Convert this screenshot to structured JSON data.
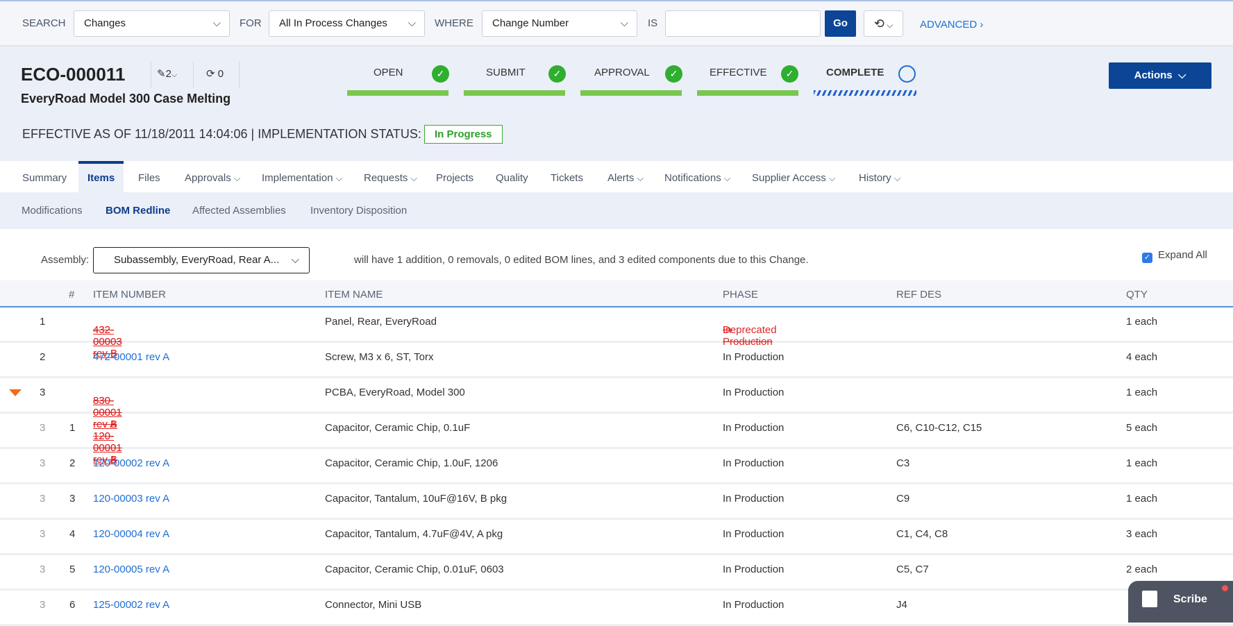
{
  "search": {
    "search_label": "SEARCH",
    "search_value": "Changes",
    "for_label": "FOR",
    "for_value": "All In Process Changes",
    "where_label": "WHERE",
    "where_value": "Change Number",
    "is_label": "IS",
    "is_value": "",
    "go_label": "Go",
    "advanced_label": "ADVANCED"
  },
  "header": {
    "number": "ECO-000011",
    "title": "EveryRoad Model 300 Case Melting",
    "revisions_count": "2",
    "related_count": "0",
    "effective_text": "EFFECTIVE AS OF 11/18/2011 14:04:06 | IMPLEMENTATION STATUS:",
    "status": "In Progress",
    "actions_label": "Actions",
    "steps": [
      {
        "label": "OPEN",
        "done": true
      },
      {
        "label": "SUBMIT",
        "done": true
      },
      {
        "label": "APPROVAL",
        "done": true
      },
      {
        "label": "EFFECTIVE",
        "done": true
      },
      {
        "label": "COMPLETE",
        "done": false
      }
    ]
  },
  "colors": {
    "brand": "#0c4596",
    "complete": "#7ac74f",
    "check": "#2fae2f",
    "redline": "#e02525",
    "link": "#1f6fd1"
  },
  "tabs": [
    "Summary",
    "Items",
    "Files",
    "Approvals",
    "Implementation",
    "Requests",
    "Projects",
    "Quality",
    "Tickets",
    "Alerts",
    "Notifications",
    "Supplier Access",
    "History"
  ],
  "subtabs": [
    "Modifications",
    "BOM Redline",
    "Affected Assemblies",
    "Inventory Disposition"
  ],
  "bom": {
    "assembly_label": "Assembly:",
    "assembly_value": "Subassembly, EveryRoad, Rear A...",
    "summary": "will have 1 addition, 0 removals, 0 edited BOM lines, and 3 edited components due to this Change.",
    "expand_all_label": "Expand All",
    "expand_all_checked": true,
    "columns": [
      "#",
      "ITEM NUMBER",
      "ITEM NAME",
      "PHASE",
      "REF DES",
      "QTY"
    ],
    "rows": [
      {
        "parent": "",
        "num": "1",
        "old_item": "432-00003 rev B",
        "item": "432-00003 rev B",
        "name": "Panel, Rear, EveryRoad",
        "old_phase": "In Production",
        "phase": "Deprecated",
        "refdes": "",
        "qty": "1 each"
      },
      {
        "parent": "",
        "num": "2",
        "old_item": "",
        "item": "472-00001 rev A",
        "name": "Screw, M3 x 6, ST, Torx",
        "old_phase": "",
        "phase": "In Production",
        "refdes": "",
        "qty": "4 each"
      },
      {
        "parent": "",
        "num": "3",
        "old_item": "830-00001 rev A",
        "item": "830-00001 rev B",
        "name": "PCBA, EveryRoad, Model 300",
        "old_phase": "",
        "phase": "In Production",
        "refdes": "",
        "qty": "1 each",
        "expanded": true
      },
      {
        "parent": "3",
        "num": "1",
        "old_item": "120-00001 rev A",
        "item": "120-00001 rev B",
        "name": "Capacitor, Ceramic Chip, 0.1uF",
        "old_phase": "",
        "phase": "In Production",
        "refdes": "C6, C10-C12, C15",
        "qty": "5 each"
      },
      {
        "parent": "3",
        "num": "2",
        "old_item": "",
        "item": "120-00002 rev A",
        "name": "Capacitor, Ceramic Chip, 1.0uF, 1206",
        "old_phase": "",
        "phase": "In Production",
        "refdes": "C3",
        "qty": "1 each"
      },
      {
        "parent": "3",
        "num": "3",
        "old_item": "",
        "item": "120-00003 rev A",
        "name": "Capacitor, Tantalum, 10uF@16V, B pkg",
        "old_phase": "",
        "phase": "In Production",
        "refdes": "C9",
        "qty": "1 each"
      },
      {
        "parent": "3",
        "num": "4",
        "old_item": "",
        "item": "120-00004 rev A",
        "name": "Capacitor, Tantalum, 4.7uF@4V, A pkg",
        "old_phase": "",
        "phase": "In Production",
        "refdes": "C1, C4, C8",
        "qty": "3 each"
      },
      {
        "parent": "3",
        "num": "5",
        "old_item": "",
        "item": "120-00005 rev A",
        "name": "Capacitor, Ceramic Chip, 0.01uF, 0603",
        "old_phase": "",
        "phase": "In Production",
        "refdes": "C5, C7",
        "qty": "2 each"
      },
      {
        "parent": "3",
        "num": "6",
        "old_item": "",
        "item": "125-00002 rev A",
        "name": "Connector, Mini USB",
        "old_phase": "",
        "phase": "In Production",
        "refdes": "J4",
        "qty": ""
      }
    ]
  },
  "scribe": {
    "label": "Scribe"
  }
}
